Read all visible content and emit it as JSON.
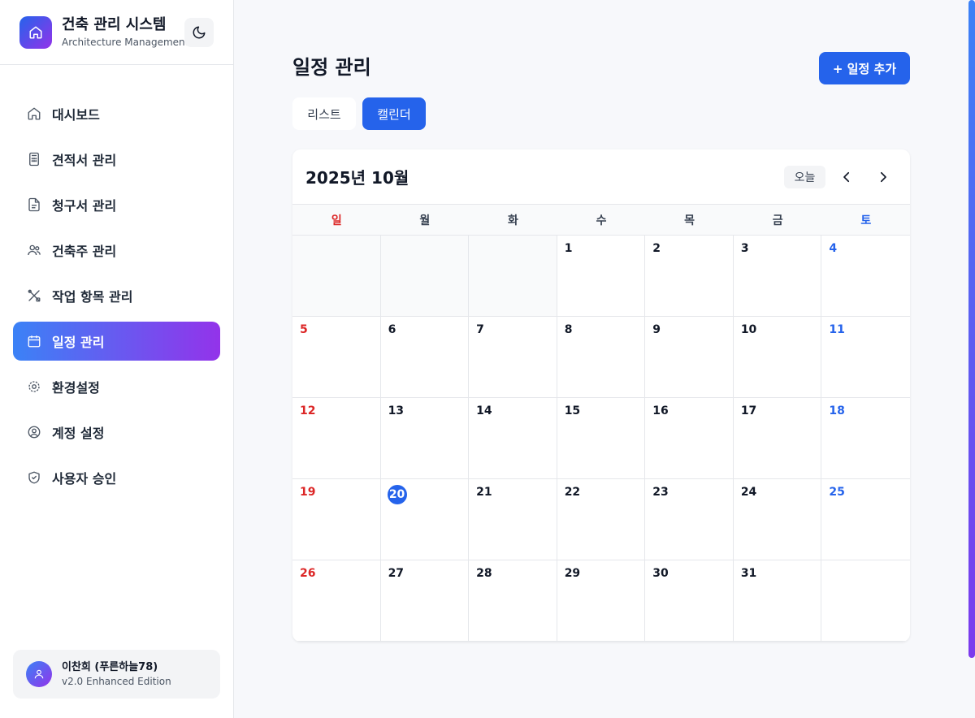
{
  "app": {
    "title": "건축 관리 시스템",
    "subtitle": "Architecture Management"
  },
  "sidebar": {
    "items": [
      {
        "label": "대시보드",
        "icon": "home-icon",
        "active": false
      },
      {
        "label": "견적서 관리",
        "icon": "calculator-icon",
        "active": false
      },
      {
        "label": "청구서 관리",
        "icon": "file-icon",
        "active": false
      },
      {
        "label": "건축주 관리",
        "icon": "users-icon",
        "active": false
      },
      {
        "label": "작업 항목 관리",
        "icon": "tools-icon",
        "active": false
      },
      {
        "label": "일정 관리",
        "icon": "calendar-icon",
        "active": true
      },
      {
        "label": "환경설정",
        "icon": "gear-icon",
        "active": false
      },
      {
        "label": "계정 설정",
        "icon": "user-circle-icon",
        "active": false
      },
      {
        "label": "사용자 승인",
        "icon": "shield-check-icon",
        "active": false
      }
    ]
  },
  "user": {
    "name": "이찬희 (푸른하늘78)",
    "version": "v2.0 Enhanced Edition"
  },
  "page": {
    "title": "일정 관리",
    "add_button": "+ 일정 추가",
    "tabs": {
      "list": "리스트",
      "calendar": "캘린더",
      "active": "calendar"
    }
  },
  "calendar": {
    "month_label": "2025년 10월",
    "today_button": "오늘",
    "weekdays": [
      "일",
      "월",
      "화",
      "수",
      "목",
      "금",
      "토"
    ],
    "leading_empty_days": 3,
    "days_in_month": 31,
    "today": 20
  },
  "colors": {
    "accent": "#2563eb",
    "gradient_end": "#9333ea",
    "sunday": "#dc2626",
    "saturday": "#2563eb"
  }
}
